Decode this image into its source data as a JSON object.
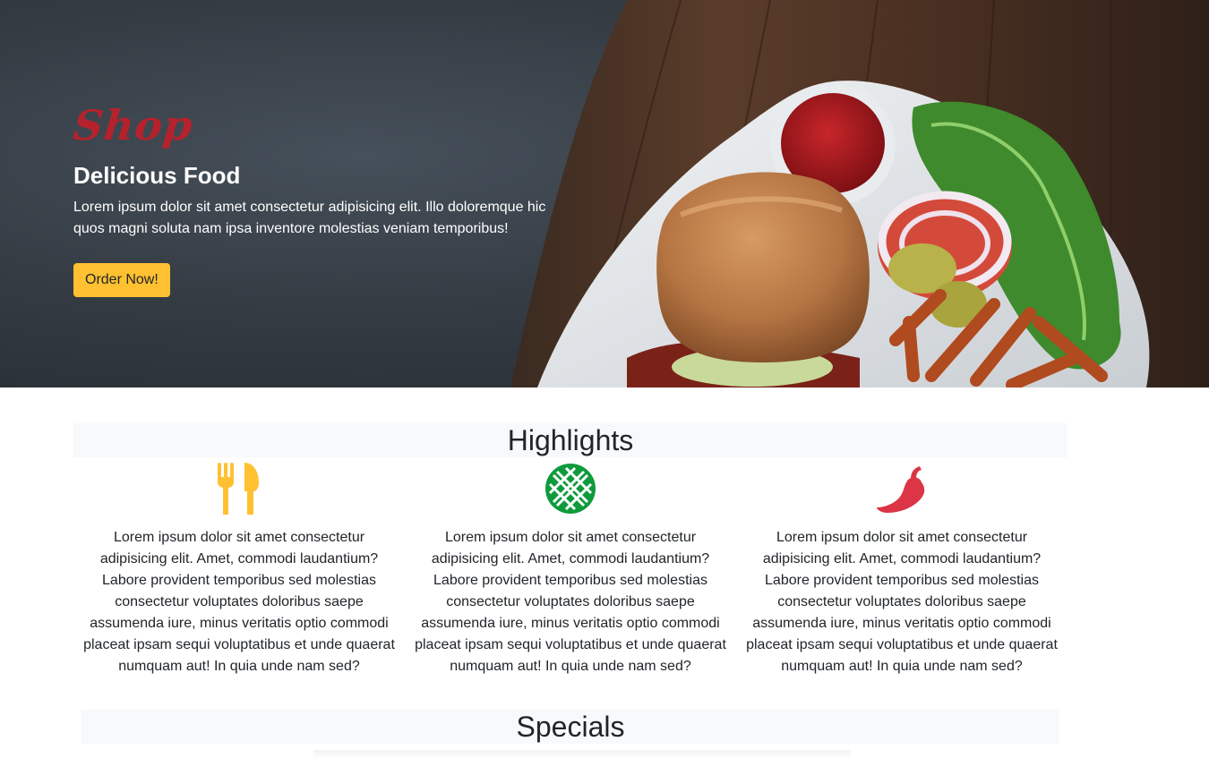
{
  "hero": {
    "brand": "Shop",
    "title": "Delicious Food",
    "text": "Lorem ipsum dolor sit amet consectetur adipisicing elit. Illo doloremque hic quos magni soluta nam ipsa inventore molestias veniam temporibus!",
    "button_label": "Order Now!",
    "image": "burger-fries-plate-photo"
  },
  "highlights": {
    "title": "Highlights",
    "items": [
      {
        "icon": "utensils-icon",
        "color": "#ffc131",
        "text": "Lorem ipsum dolor sit amet consectetur adipisicing elit. Amet, commodi laudantium? Labore provident temporibus sed molestias consectetur voluptates doloribus saepe assumenda iure, minus veritatis optio commodi placeat ipsam sequi voluptatibus et unde quaerat numquam aut! In quia unde nam sed?"
      },
      {
        "icon": "waffle-icon",
        "color": "#0f9a3c",
        "text": "Lorem ipsum dolor sit amet consectetur adipisicing elit. Amet, commodi laudantium? Labore provident temporibus sed molestias consectetur voluptates doloribus saepe assumenda iure, minus veritatis optio commodi placeat ipsam sequi voluptatibus et unde quaerat numquam aut! In quia unde nam sed?"
      },
      {
        "icon": "pepper-icon",
        "color": "#dc3545",
        "text": "Lorem ipsum dolor sit amet consectetur adipisicing elit. Amet, commodi laudantium? Labore provident temporibus sed molestias consectetur voluptates doloribus saepe assumenda iure, minus veritatis optio commodi placeat ipsam sequi voluptatibus et unde quaerat numquam aut! In quia unde nam sed?"
      }
    ]
  },
  "specials": {
    "title": "Specials"
  },
  "colors": {
    "brand": "#b5222c",
    "button": "#ffc131",
    "section_bg": "#f8f9fa"
  }
}
